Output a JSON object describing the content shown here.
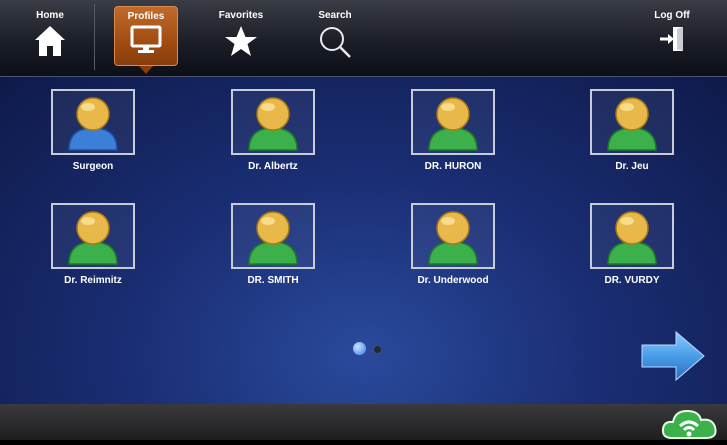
{
  "nav": {
    "home": "Home",
    "profiles": "Profiles",
    "favorites": "Favorites",
    "search": "Search",
    "logoff": "Log Off",
    "active": "Profiles"
  },
  "profiles": [
    {
      "name": "Surgeon",
      "avatar_color": "blue"
    },
    {
      "name": "Dr. Albertz",
      "avatar_color": "green"
    },
    {
      "name": "DR. HURON",
      "avatar_color": "green"
    },
    {
      "name": "Dr. Jeu",
      "avatar_color": "green"
    },
    {
      "name": "Dr. Reimnitz",
      "avatar_color": "green"
    },
    {
      "name": "DR. SMITH",
      "avatar_color": "green"
    },
    {
      "name": "Dr. Underwood",
      "avatar_color": "green"
    },
    {
      "name": "DR. VURDY",
      "avatar_color": "green"
    }
  ],
  "pagination": {
    "current": 1,
    "total": 2
  },
  "icons": {
    "home": "home-icon",
    "profiles": "monitor-icon",
    "favorites": "star-icon",
    "search": "search-icon",
    "logoff": "logoff-door-icon",
    "next": "arrow-right-icon",
    "wireless": "cloud-wifi-icon"
  },
  "colors": {
    "active_tab": "#a14c12",
    "background": "#1a2e74",
    "avatar_head": "#e8b84a",
    "avatar_body_green": "#3cb04a",
    "avatar_body_blue": "#3b7fd8",
    "arrow": "#4a9de8",
    "cloud": "#3cb04a"
  }
}
